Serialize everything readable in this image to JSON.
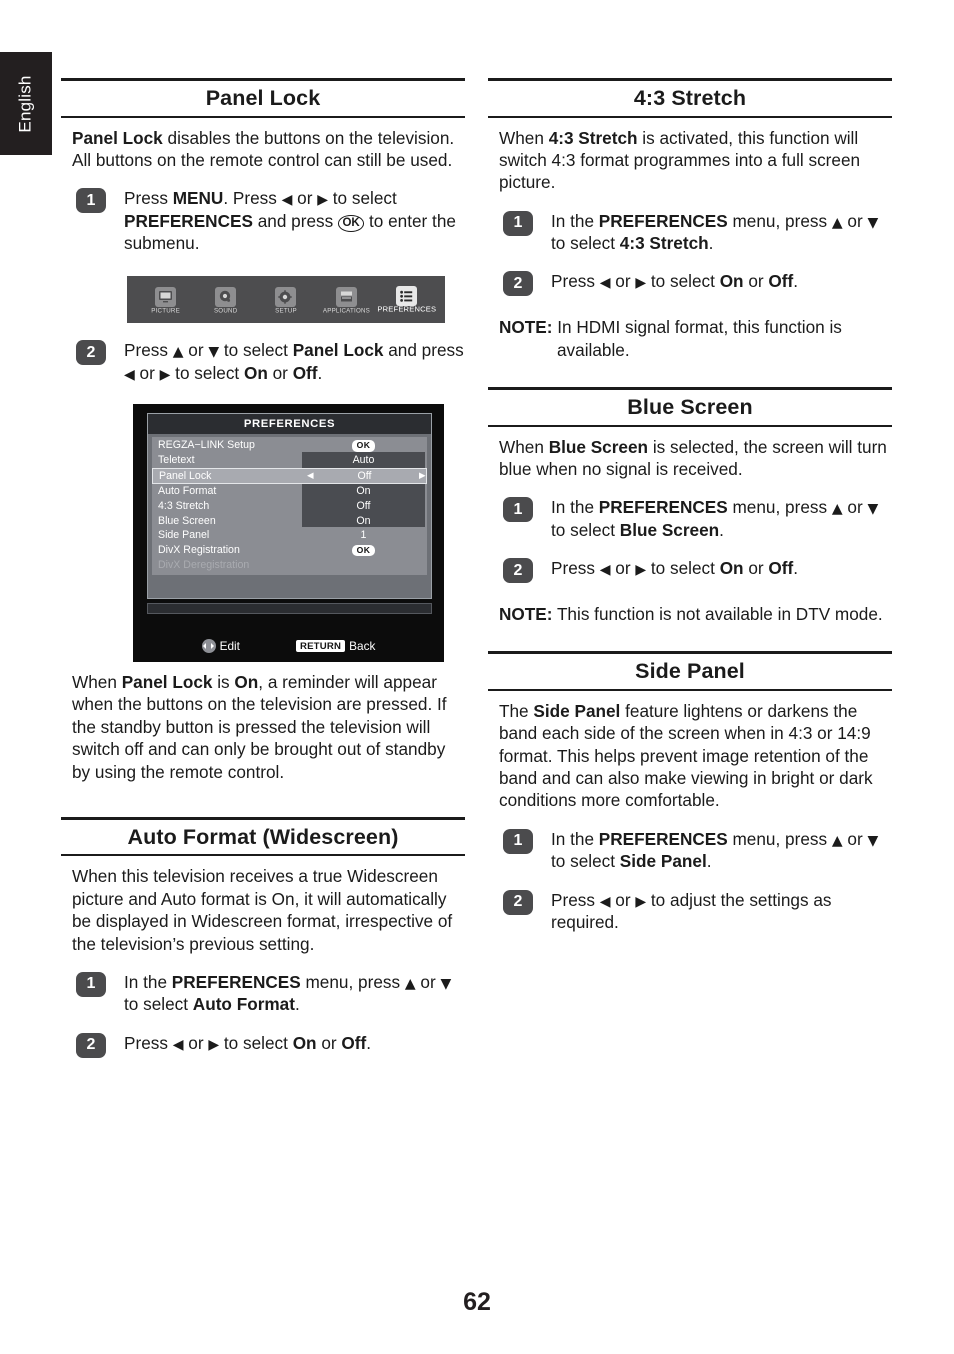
{
  "page": {
    "language_tab": "English",
    "number": "62"
  },
  "sections": {
    "panel_lock": {
      "title": "Panel Lock",
      "intro_html": "<b>Panel Lock</b> disables the buttons on the television. All buttons on the remote control can still be used.",
      "steps": [
        {
          "num": "1",
          "text_html": "Press <b>MENU</b>. Press <span class=\"arr\">&#9664;</span> or <span class=\"arr\">&#9654;</span> to select <b>PREFERENCES</b> and press <span class=\"ok-inline\">OK</span> to enter the submenu."
        },
        {
          "num": "2",
          "text_html": "Press <span class=\"arr\">&#9650;</span> or <span class=\"arr\">&#9660;</span> to select <b>Panel Lock</b> and press <span class=\"arr\">&#9664;</span> or <span class=\"arr\">&#9654;</span> to select <b>On</b> or <b>Off</b>."
        }
      ],
      "outro_html": "When <b>Panel Lock</b> is <b>On</b>, a reminder will appear when the buttons on the television are pressed. If the standby button is pressed the television will switch off and can only be brought out of standby by using the remote control."
    },
    "auto_format": {
      "title": "Auto Format (Widescreen)",
      "intro_html": "When this television receives a true Widescreen picture and Auto format is On, it will automatically be displayed in Widescreen format, irrespective of the television&#8217;s previous setting.",
      "steps": [
        {
          "num": "1",
          "text_html": "In the <b>PREFERENCES</b> menu, press <span class=\"arr\">&#9650;</span> or <span class=\"arr\">&#9660;</span> to select <b>Auto Format</b>."
        },
        {
          "num": "2",
          "text_html": "Press <span class=\"arr\">&#9664;</span> or <span class=\"arr\">&#9654;</span> to select <b>On</b> or <b>Off</b>."
        }
      ]
    },
    "stretch_43": {
      "title": "4:3 Stretch",
      "intro_html": "When <b>4:3 Stretch</b> is activated, this function will switch 4:3 format programmes into a full screen picture.",
      "steps": [
        {
          "num": "1",
          "text_html": "In the <b>PREFERENCES</b> menu, press <span class=\"arr\">&#9650;</span> or <span class=\"arr\">&#9660;</span> to select <b>4:3 Stretch</b>."
        },
        {
          "num": "2",
          "text_html": "Press <span class=\"arr\">&#9664;</span> or <span class=\"arr\">&#9654;</span> to select <b>On</b> or <b>Off</b>."
        }
      ],
      "note_label": "NOTE:",
      "note_text": "In HDMI signal format, this function is available."
    },
    "blue_screen": {
      "title": "Blue Screen",
      "intro_html": "When <b>Blue Screen</b> is selected, the screen will turn blue when no signal is received.",
      "steps": [
        {
          "num": "1",
          "text_html": "In the <b>PREFERENCES</b> menu, press <span class=\"arr\">&#9650;</span> or <span class=\"arr\">&#9660;</span> to select <b>Blue Screen</b>."
        },
        {
          "num": "2",
          "text_html": "Press <span class=\"arr\">&#9664;</span> or <span class=\"arr\">&#9654;</span> to select <b>On</b> or <b>Off</b>."
        }
      ],
      "note_label": "NOTE:",
      "note_text": "This function is not available in DTV mode."
    },
    "side_panel": {
      "title": "Side Panel",
      "intro_html": "The <b>Side Panel</b> feature lightens or darkens the band each side of the screen when in 4:3 or 14:9 format. This helps prevent image retention of the band and can also make viewing in bright or dark conditions more comfortable.",
      "steps": [
        {
          "num": "1",
          "text_html": "In the <b>PREFERENCES</b> menu, press <span class=\"arr\">&#9650;</span> or <span class=\"arr\">&#9660;</span> to select <b>Side Panel</b>."
        },
        {
          "num": "2",
          "text_html": "Press <span class=\"arr\">&#9664;</span> or <span class=\"arr\">&#9654;</span> to adjust the settings as required."
        }
      ]
    }
  },
  "figures": {
    "menu_iconbar": {
      "items": [
        {
          "label": "PICTURE",
          "icon": "picture-icon",
          "selected": false
        },
        {
          "label": "SOUND",
          "icon": "sound-icon",
          "selected": false
        },
        {
          "label": "SETUP",
          "icon": "setup-gear-icon",
          "selected": false
        },
        {
          "label": "APPLICATIONS",
          "icon": "applications-icon",
          "selected": false
        },
        {
          "label": "PREFERENCES",
          "icon": "preferences-list-icon",
          "selected": true
        }
      ]
    },
    "osd_preferences": {
      "title": "PREFERENCES",
      "rows": [
        {
          "name": "REGZA−LINK Setup",
          "value": "OK",
          "type": "ok",
          "state": "normal"
        },
        {
          "name": "Teletext",
          "value": "Auto",
          "type": "value",
          "state": "normal"
        },
        {
          "name": "Panel Lock",
          "value": "Off",
          "type": "adjustable",
          "state": "highlight"
        },
        {
          "name": "Auto Format",
          "value": "On",
          "type": "value",
          "state": "normal"
        },
        {
          "name": "4:3 Stretch",
          "value": "Off",
          "type": "value",
          "state": "normal"
        },
        {
          "name": "Blue Screen",
          "value": "On",
          "type": "value",
          "state": "normal"
        },
        {
          "name": "Side Panel",
          "value": "1",
          "type": "value",
          "state": "normal"
        },
        {
          "name": "DivX Registration",
          "value": "OK",
          "type": "ok",
          "state": "normal"
        },
        {
          "name": "DivX Deregistration",
          "value": "",
          "type": "none",
          "state": "disabled"
        }
      ],
      "footer": {
        "edit_label": "Edit",
        "return_key": "RETURN",
        "back_label": "Back"
      }
    }
  }
}
